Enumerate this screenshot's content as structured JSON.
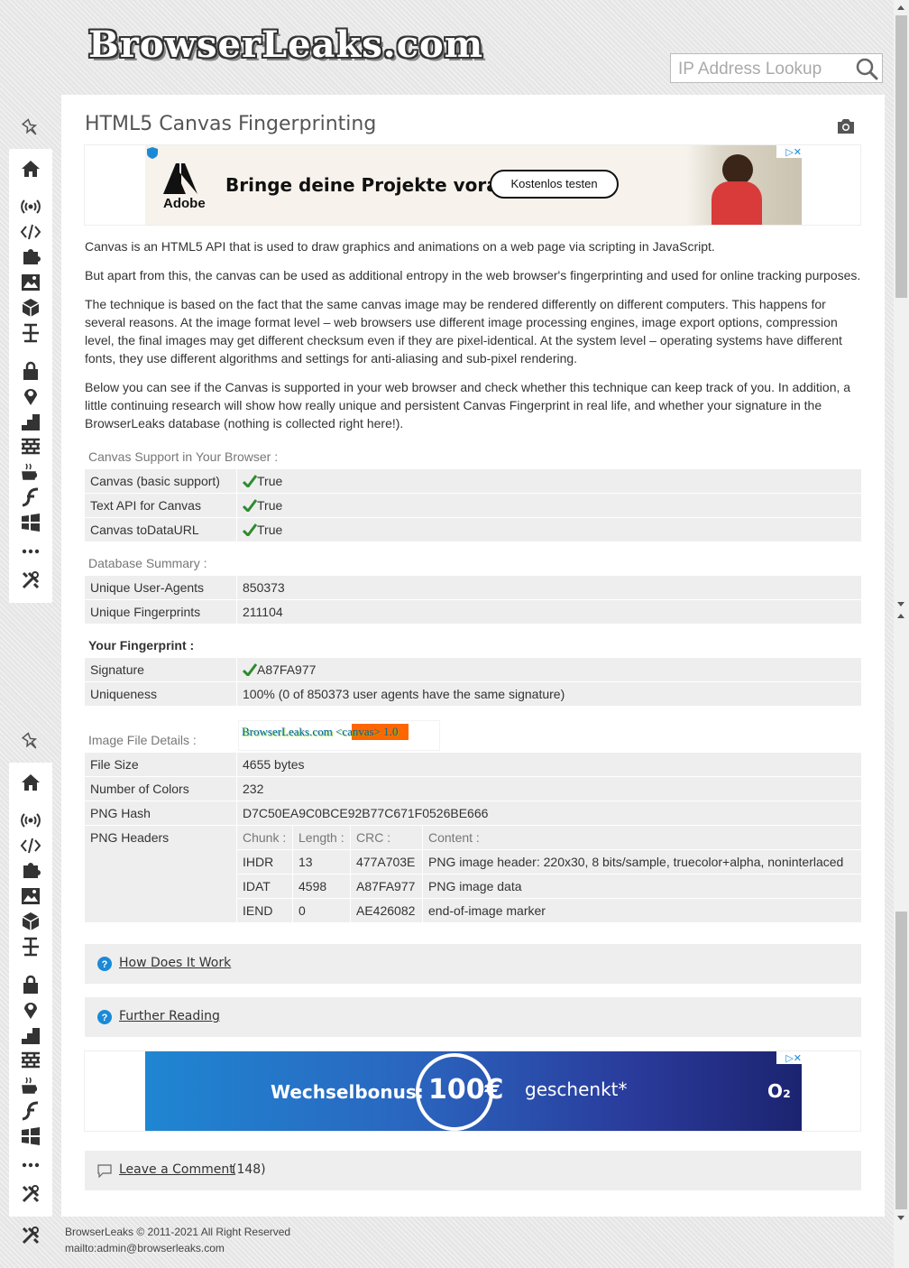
{
  "header": {
    "logo_text": "BrowserLeaks.com",
    "search_placeholder": "IP Address Lookup"
  },
  "sidebar": {
    "icons": [
      "pin-icon",
      "home-icon",
      "broadcast-icon",
      "code-icon",
      "puzzle-icon",
      "image-icon",
      "cube-icon",
      "text-cursor-icon",
      "lock-icon",
      "location-icon",
      "stairs-icon",
      "wall-icon",
      "coffee-icon",
      "flash-icon",
      "windows-icon",
      "more-icon",
      "tools-icon"
    ]
  },
  "page": {
    "title": "HTML5 Canvas Fingerprinting"
  },
  "ad_top": {
    "brand": "Adobe",
    "headline": "Bringe deine Projekte voran.",
    "cta": "Kostenlos testen"
  },
  "intro": {
    "p1": "Canvas is an HTML5 API that is used to draw graphics and animations on a web page via scripting in JavaScript.",
    "p2": "But apart from this, the canvas can be used as additional entropy in the web browser's fingerprinting and used for online tracking purposes.",
    "p3": "The technique is based on the fact that the same canvas image may be rendered differently on different computers. This happens for several reasons. At the image format level – web browsers use different image processing engines, image export options, compression level, the final images may get different checksum even if they are pixel-identical. At the system level – operating systems have different fonts, they use different algorithms and settings for anti-aliasing and sub-pixel rendering.",
    "p4": "Below you can see if the Canvas is supported in your web browser and check whether this technique can keep track of you. In addition, a little continuing research will show how really unique and persistent Canvas Fingerprint in real life, and whether your signature in the BrowserLeaks database (nothing is collected right here!)."
  },
  "support": {
    "label": "Canvas Support in Your Browser :",
    "rows": [
      {
        "key": "Canvas (basic support)",
        "value": "True"
      },
      {
        "key": "Text API for Canvas",
        "value": "True"
      },
      {
        "key": "Canvas toDataURL",
        "value": "True"
      }
    ]
  },
  "database": {
    "label": "Database Summary :",
    "rows": [
      {
        "key": "Unique User-Agents",
        "value": "850373"
      },
      {
        "key": "Unique Fingerprints",
        "value": "211104"
      }
    ]
  },
  "fingerprint": {
    "label": "Your Fingerprint :",
    "signature_key": "Signature",
    "signature_value": "A87FA977",
    "uniqueness_key": "Uniqueness",
    "uniqueness_value": "100% (0 of 850373 user agents have the same signature)"
  },
  "image_details": {
    "label": "Image File Details :",
    "canvas_text": "BrowserLeaks.com <canvas> 1.0",
    "rows": [
      {
        "key": "File Size",
        "value": "4655 bytes"
      },
      {
        "key": "Number of Colors",
        "value": "232"
      },
      {
        "key": "PNG Hash",
        "value": "D7C50EA9C0BCE92B77C671F0526BE666"
      }
    ],
    "png_headers_key": "PNG Headers",
    "png_columns": [
      "Chunk :",
      "Length :",
      "CRC :",
      "Content :"
    ],
    "png_rows": [
      [
        "IHDR",
        "13",
        "477A703E",
        "PNG image header: 220x30, 8 bits/sample, truecolor+alpha, noninterlaced"
      ],
      [
        "IDAT",
        "4598",
        "A87FA977",
        "PNG image data"
      ],
      [
        "IEND",
        "0",
        "AE426082",
        "end-of-image marker"
      ]
    ]
  },
  "accordions": {
    "how": "How Does It Work",
    "further": "Further Reading",
    "comment": "Leave a Comment",
    "comment_count": "(148)"
  },
  "ad_bottom": {
    "text_left": "Wechselbonus:",
    "amount": "100€",
    "text_right": "geschenkt*",
    "brand": "O₂"
  },
  "footer": {
    "copyright": "BrowserLeaks © 2011-2021 All Right Reserved",
    "email": "mailto:admin@browserleaks.com"
  },
  "colors": {
    "check_green": "#2e8b2e",
    "accent_blue": "#1a8ad8",
    "row_bg": "#eeeeee"
  }
}
